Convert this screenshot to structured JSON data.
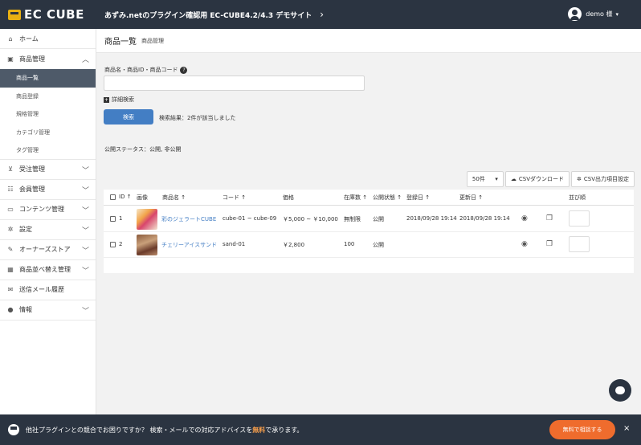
{
  "header": {
    "logo_text": "EC CUBE",
    "site_title": "あずみ.netのプラグイン確認用 EC-CUBE4.2/4.3 デモサイト",
    "site_chevron": "›",
    "user_name": "demo 様",
    "user_caret": "▾"
  },
  "sidebar": {
    "items": [
      {
        "label": "ホーム",
        "icon": "home-icon"
      },
      {
        "label": "商品管理",
        "icon": "box-icon",
        "expanded": true,
        "children": [
          "商品一覧",
          "商品登録",
          "規格管理",
          "カテゴリ管理",
          "タグ管理"
        ]
      },
      {
        "label": "受注管理",
        "icon": "cart-icon"
      },
      {
        "label": "会員管理",
        "icon": "users-icon"
      },
      {
        "label": "コンテンツ管理",
        "icon": "document-icon"
      },
      {
        "label": "設定",
        "icon": "gear-icon"
      },
      {
        "label": "オーナーズストア",
        "icon": "store-icon"
      },
      {
        "label": "商品並べ替え管理",
        "icon": "sort-icon"
      },
      {
        "label": "送信メール履歴",
        "icon": "mail-icon"
      },
      {
        "label": "情報",
        "icon": "info-icon"
      }
    ],
    "active_child": "商品一覧"
  },
  "page": {
    "title": "商品一覧",
    "subtitle": "商品管理"
  },
  "search": {
    "label": "商品名・商品ID・商品コード",
    "help": "?",
    "value": "",
    "placeholder": "",
    "advanced_label": "詳細検索",
    "advanced_icon": "+",
    "button_label": "検索",
    "result_text": "検索結果：2件が該当しました",
    "status_text": "公開ステータス：公開, 非公開"
  },
  "toolbar": {
    "per_page": "50件",
    "csv_download": "CSVダウンロード",
    "csv_settings": "CSV出力項目設定"
  },
  "table": {
    "headers": [
      "ID",
      "画像",
      "商品名",
      "コード",
      "価格",
      "在庫数",
      "公開状態",
      "登録日",
      "更新日",
      "並び順"
    ],
    "sort_mark": "↑",
    "rows": [
      {
        "id": "1",
        "name": "彩のジェラートCUBE",
        "code": "cube-01 ~ cube-09",
        "price": "￥5,000 ~ ￥10,000",
        "stock": "無制限",
        "status": "公開",
        "created": "2018/09/28 19:14",
        "updated": "2018/09/28 19:14"
      },
      {
        "id": "2",
        "name": "チェリーアイスサンド",
        "code": "sand-01",
        "price": "￥2,800",
        "stock": "100",
        "status": "公開",
        "created": "2018/09/28 19:14",
        "updated": "2018/09/28 19:14"
      }
    ]
  },
  "banner": {
    "text": "他社プラグインとの競合でお困りですか？ 検索・メールでの対応アドバイスを",
    "highlight": "無料",
    "text_tail": "で承ります。",
    "button": "無料で相談する",
    "close": "×"
  },
  "colors": {
    "header_bg": "#2b3441",
    "accent": "#437ec4",
    "cta": "#ef6c2d",
    "active_nav": "#4e5a69"
  }
}
